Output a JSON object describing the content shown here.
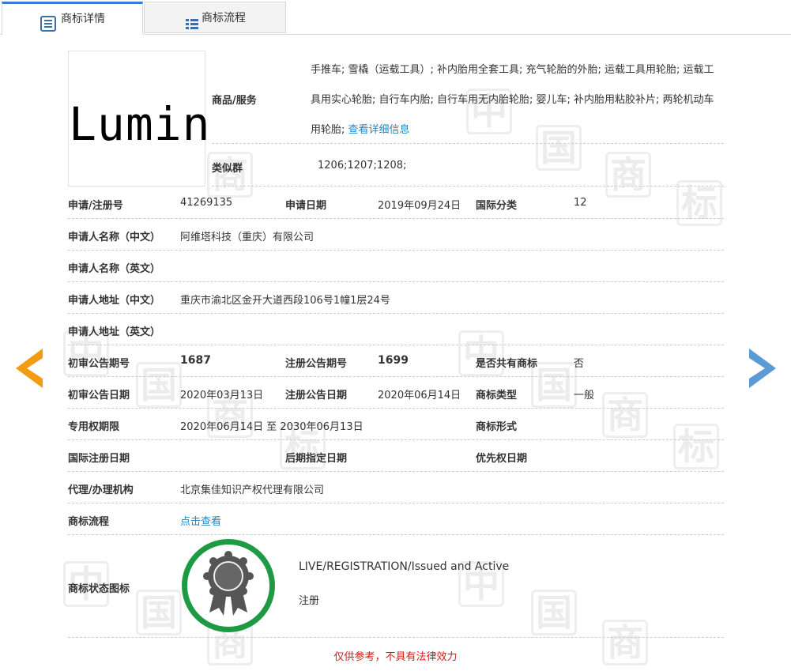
{
  "tabs": [
    {
      "label": "商标详情",
      "active": true,
      "icon": "document-list-icon"
    },
    {
      "label": "商标流程",
      "active": false,
      "icon": "list-icon"
    }
  ],
  "trademark": {
    "logo_text": "Lumin",
    "goods_label": "商品/服务",
    "goods_text": "手推车; 雪橇（运载工具）; 补内胎用全套工具; 充气轮胎的外胎; 运载工具用轮胎; 运载工具用实心轮胎; 自行车内胎; 自行车用无内胎轮胎; 婴儿车; 补内胎用粘胶补片; 两轮机动车用轮胎;",
    "goods_link": "查看详细信息",
    "similar_label": "类似群",
    "similar_value": "1206;1207;1208;"
  },
  "fields": {
    "reg_no_label": "申请/注册号",
    "reg_no": "41269135",
    "apply_date_label": "申请日期",
    "apply_date": "2019年09月24日",
    "intl_class_label": "国际分类",
    "intl_class": "12",
    "applicant_cn_label": "申请人名称（中文）",
    "applicant_cn": "阿维塔科技（重庆）有限公司",
    "applicant_en_label": "申请人名称（英文）",
    "applicant_en": "",
    "address_cn_label": "申请人地址（中文）",
    "address_cn": "重庆市渝北区金开大道西段106号1幢1层24号",
    "address_en_label": "申请人地址（英文）",
    "address_en": "",
    "prelim_no_label": "初审公告期号",
    "prelim_no": "1687",
    "reg_pub_no_label": "注册公告期号",
    "reg_pub_no": "1699",
    "shared_label": "是否共有商标",
    "shared": "否",
    "prelim_date_label": "初审公告日期",
    "prelim_date": "2020年03月13日",
    "reg_pub_date_label": "注册公告日期",
    "reg_pub_date": "2020年06月14日",
    "tm_type_label": "商标类型",
    "tm_type": "一般",
    "term_label": "专用权期限",
    "term": "2020年06月14日 至 2030年06月13日",
    "tm_form_label": "商标形式",
    "tm_form": "",
    "intl_reg_date_label": "国际注册日期",
    "intl_reg_date": "",
    "later_date_label": "后期指定日期",
    "later_date": "",
    "priority_date_label": "优先权日期",
    "priority_date": "",
    "agent_label": "代理/办理机构",
    "agent": "北京集佳知识产权代理有限公司",
    "process_label": "商标流程",
    "process_link": "点击查看",
    "status_label": "商标状态图标",
    "status_en": "LIVE/REGISTRATION/Issued and Active",
    "status_cn": "注册"
  },
  "footer_note": "仅供参考，不具有法律效力",
  "colors": {
    "accent_blue": "#1e88c8",
    "arrow_left": "#f39c12",
    "arrow_right": "#5b9bd5",
    "badge_ring": "#1f9a44",
    "note_red": "#d21c1c"
  }
}
